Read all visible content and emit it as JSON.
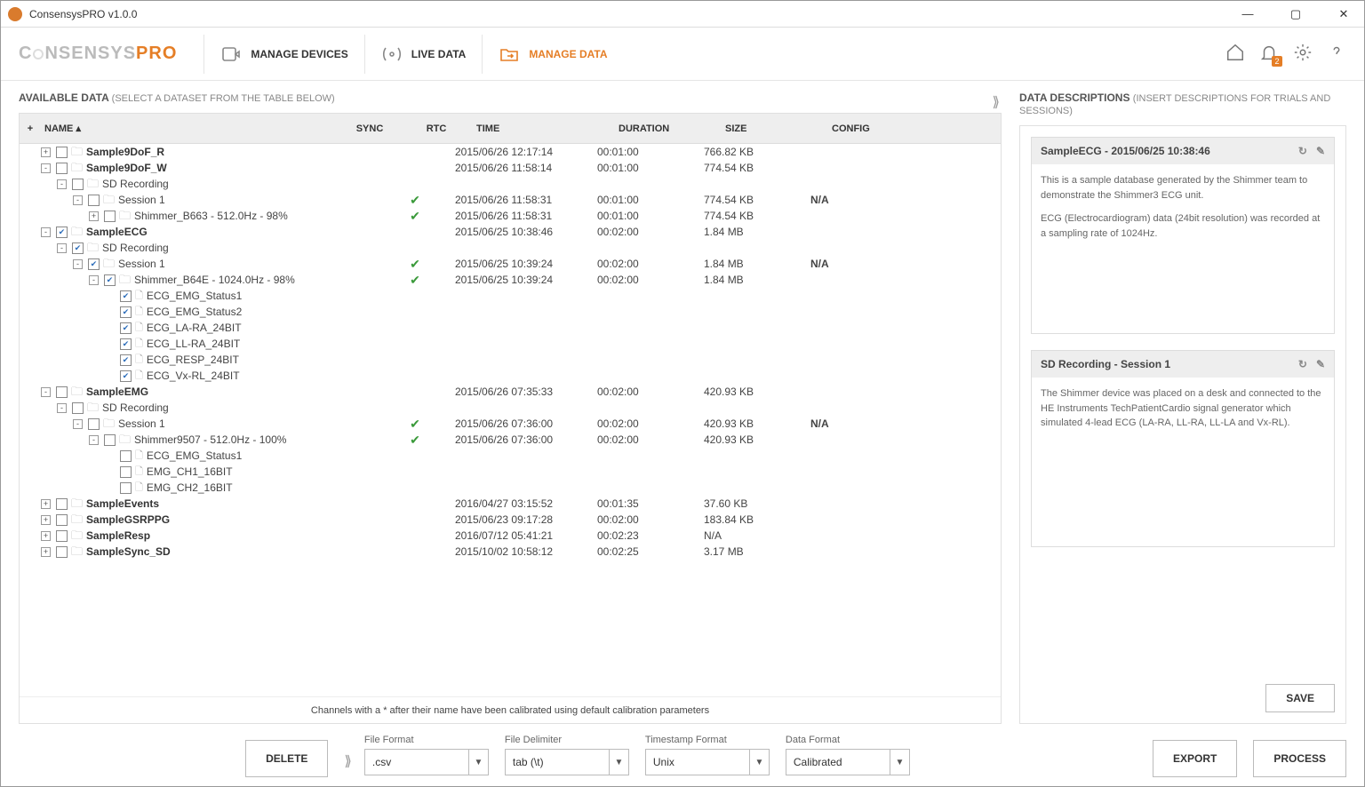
{
  "app": {
    "title": "ConsensysPRO v1.0.0",
    "logo_a": "C",
    "logo_b": "NSENSYS",
    "logo_c": "PRO"
  },
  "toolbar": {
    "manage_devices": "MANAGE DEVICES",
    "live_data": "LIVE DATA",
    "manage_data": "MANAGE DATA",
    "notif_count": "2"
  },
  "left": {
    "heading": "AVAILABLE DATA",
    "sub": "(SELECT A DATASET FROM THE TABLE BELOW)",
    "plus": "+",
    "columns": {
      "name": "NAME ▴",
      "sync": "SYNC",
      "rtc": "RTC",
      "time": "TIME",
      "duration": "DURATION",
      "size": "SIZE",
      "config": "CONFIG"
    },
    "footnote": "Channels with a * after their name have been calibrated using default calibration parameters"
  },
  "rows": [
    {
      "indent": 0,
      "twist": "+",
      "checked": false,
      "type": "folder",
      "name": "Sample9DoF_R",
      "bold": true,
      "time": "2015/06/26 12:17:14",
      "dur": "00:01:00",
      "size": "766.82 KB"
    },
    {
      "indent": 0,
      "twist": "-",
      "checked": false,
      "type": "folder",
      "name": "Sample9DoF_W",
      "bold": true,
      "time": "2015/06/26 11:58:14",
      "dur": "00:01:00",
      "size": "774.54 KB"
    },
    {
      "indent": 1,
      "twist": "-",
      "checked": false,
      "type": "folder",
      "name": "SD Recording",
      "bold": false
    },
    {
      "indent": 2,
      "twist": "-",
      "checked": false,
      "type": "folder",
      "name": "Session 1",
      "bold": false,
      "rtc": true,
      "time": "2015/06/26 11:58:31",
      "dur": "00:01:00",
      "size": "774.54 KB",
      "config": "N/A"
    },
    {
      "indent": 3,
      "twist": "+",
      "checked": false,
      "type": "folder",
      "name": "Shimmer_B663 - 512.0Hz - 98%",
      "bold": false,
      "rtc": true,
      "time": "2015/06/26 11:58:31",
      "dur": "00:01:00",
      "size": "774.54 KB"
    },
    {
      "indent": 0,
      "twist": "-",
      "checked": true,
      "type": "folder",
      "name": "SampleECG",
      "bold": true,
      "time": "2015/06/25 10:38:46",
      "dur": "00:02:00",
      "size": "1.84 MB"
    },
    {
      "indent": 1,
      "twist": "-",
      "checked": true,
      "type": "folder",
      "name": "SD Recording",
      "bold": false
    },
    {
      "indent": 2,
      "twist": "-",
      "checked": true,
      "type": "folder",
      "name": "Session 1",
      "bold": false,
      "rtc": true,
      "time": "2015/06/25 10:39:24",
      "dur": "00:02:00",
      "size": "1.84 MB",
      "config": "N/A"
    },
    {
      "indent": 3,
      "twist": "-",
      "checked": true,
      "type": "folder",
      "name": "Shimmer_B64E - 1024.0Hz - 98%",
      "bold": false,
      "rtc": true,
      "time": "2015/06/25 10:39:24",
      "dur": "00:02:00",
      "size": "1.84 MB"
    },
    {
      "indent": 4,
      "twist": "",
      "checked": true,
      "type": "file",
      "name": "ECG_EMG_Status1"
    },
    {
      "indent": 4,
      "twist": "",
      "checked": true,
      "type": "file",
      "name": "ECG_EMG_Status2"
    },
    {
      "indent": 4,
      "twist": "",
      "checked": true,
      "type": "file",
      "name": "ECG_LA-RA_24BIT"
    },
    {
      "indent": 4,
      "twist": "",
      "checked": true,
      "type": "file",
      "name": "ECG_LL-RA_24BIT"
    },
    {
      "indent": 4,
      "twist": "",
      "checked": true,
      "type": "file",
      "name": "ECG_RESP_24BIT"
    },
    {
      "indent": 4,
      "twist": "",
      "checked": true,
      "type": "file",
      "name": "ECG_Vx-RL_24BIT"
    },
    {
      "indent": 0,
      "twist": "-",
      "checked": false,
      "type": "folder",
      "name": "SampleEMG",
      "bold": true,
      "time": "2015/06/26 07:35:33",
      "dur": "00:02:00",
      "size": "420.93 KB"
    },
    {
      "indent": 1,
      "twist": "-",
      "checked": false,
      "type": "folder",
      "name": "SD Recording",
      "bold": false
    },
    {
      "indent": 2,
      "twist": "-",
      "checked": false,
      "type": "folder",
      "name": "Session 1",
      "bold": false,
      "rtc": true,
      "time": "2015/06/26 07:36:00",
      "dur": "00:02:00",
      "size": "420.93 KB",
      "config": "N/A"
    },
    {
      "indent": 3,
      "twist": "-",
      "checked": false,
      "type": "folder",
      "name": "Shimmer9507 - 512.0Hz - 100%",
      "bold": false,
      "rtc": true,
      "time": "2015/06/26 07:36:00",
      "dur": "00:02:00",
      "size": "420.93 KB"
    },
    {
      "indent": 4,
      "twist": "",
      "checked": false,
      "type": "file",
      "name": "ECG_EMG_Status1"
    },
    {
      "indent": 4,
      "twist": "",
      "checked": false,
      "type": "file",
      "name": "EMG_CH1_16BIT"
    },
    {
      "indent": 4,
      "twist": "",
      "checked": false,
      "type": "file",
      "name": "EMG_CH2_16BIT"
    },
    {
      "indent": 0,
      "twist": "+",
      "checked": false,
      "type": "folder",
      "name": "SampleEvents",
      "bold": true,
      "time": "2016/04/27 03:15:52",
      "dur": "00:01:35",
      "size": "37.60 KB"
    },
    {
      "indent": 0,
      "twist": "+",
      "checked": false,
      "type": "folder",
      "name": "SampleGSRPPG",
      "bold": true,
      "time": "2015/06/23 09:17:28",
      "dur": "00:02:00",
      "size": "183.84 KB"
    },
    {
      "indent": 0,
      "twist": "+",
      "checked": false,
      "type": "folder",
      "name": "SampleResp",
      "bold": true,
      "time": "2016/07/12 05:41:21",
      "dur": "00:02:23",
      "size": "N/A"
    },
    {
      "indent": 0,
      "twist": "+",
      "checked": false,
      "type": "folder",
      "name": "SampleSync_SD",
      "bold": true,
      "time": "2015/10/02 10:58:12",
      "dur": "00:02:25",
      "size": "3.17 MB"
    }
  ],
  "right": {
    "heading": "DATA DESCRIPTIONS",
    "sub": "(INSERT DESCRIPTIONS FOR TRIALS AND SESSIONS)",
    "card1": {
      "title": "SampleECG - 2015/06/25 10:38:46",
      "p1": "This is a sample database generated by the Shimmer team to demonstrate the Shimmer3 ECG unit.",
      "p2": "ECG (Electrocardiogram) data (24bit resolution) was recorded at a sampling rate of 1024Hz."
    },
    "card2": {
      "title": "SD Recording - Session 1",
      "p1": "The Shimmer device was placed on a desk and connected to the HE Instruments TechPatientCardio signal generator which simulated 4-lead ECG (LA-RA, LL-RA, LL-LA and Vx-RL)."
    },
    "save": "SAVE"
  },
  "bottom": {
    "delete": "DELETE",
    "file_format_l": "File Format",
    "file_format_v": ".csv",
    "file_delim_l": "File Delimiter",
    "file_delim_v": "tab (\\t)",
    "ts_format_l": "Timestamp Format",
    "ts_format_v": "Unix",
    "data_format_l": "Data Format",
    "data_format_v": "Calibrated",
    "export": "EXPORT",
    "process": "PROCESS"
  }
}
